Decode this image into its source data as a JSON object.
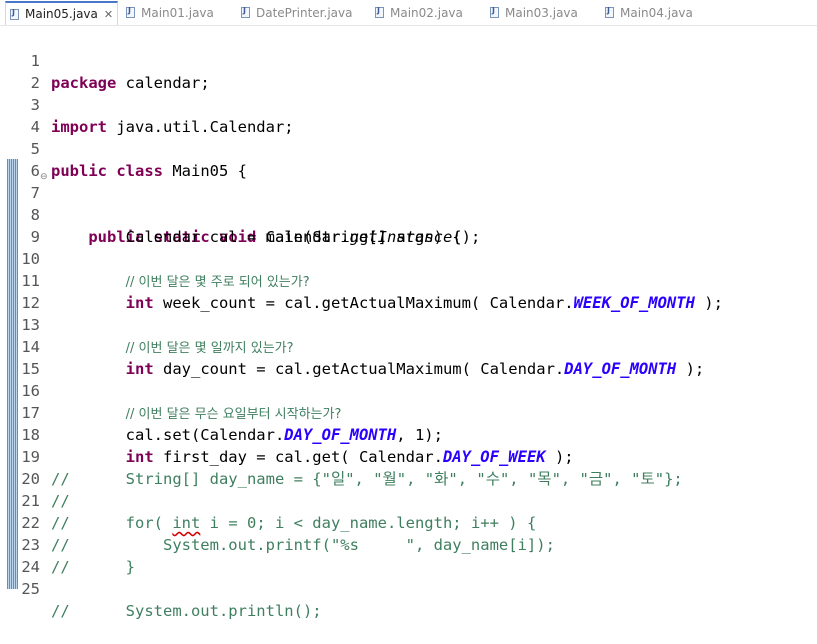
{
  "tabs": [
    {
      "label": "Main05.java",
      "active": true,
      "closable": true
    },
    {
      "label": "Main01.java",
      "active": false
    },
    {
      "label": "DatePrinter.java",
      "active": false
    },
    {
      "label": "Main02.java",
      "active": false
    },
    {
      "label": "Main03.java",
      "active": false
    },
    {
      "label": "Main04.java",
      "active": false
    }
  ],
  "editor": {
    "line_numbers": [
      "1",
      "2",
      "3",
      "4",
      "5",
      "6",
      "7",
      "8",
      "9",
      "10",
      "11",
      "12",
      "13",
      "14",
      "15",
      "16",
      "17",
      "18",
      "19",
      "20",
      "21",
      "22",
      "23",
      "24",
      "25"
    ],
    "code": {
      "l1_kw": "package",
      "l1_rest": " calendar;",
      "l3_kw": "import",
      "l3_rest": " java.util.Calendar;",
      "l5_kw1": "public",
      "l5_kw2": "class",
      "l5_rest": " Main05 {",
      "l7_kw1": "public",
      "l7_kw2": "static",
      "l7_kw3": "void",
      "l7_rest": " main(String[] args) {",
      "l8_a": "Calendar cal = Calendar.",
      "l8_it": "getInstance",
      "l8_b": "();",
      "l10_cm": "// 이번 달은 몇 주로 되어 있는가?",
      "l11_kw": "int",
      "l11_a": " week_count = cal.getActualMaximum( Calendar.",
      "l11_st": "WEEK_OF_MONTH",
      "l11_b": " );",
      "l13_cm": "// 이번 달은 몇 일까지 있는가?",
      "l14_kw": "int",
      "l14_a": " day_count = cal.getActualMaximum( Calendar.",
      "l14_st": "DAY_OF_MONTH",
      "l14_b": " );",
      "l16_cm": "// 이번 달은 무슨 요일부터 시작하는가?",
      "l17_a": "cal.set(Calendar.",
      "l17_st": "DAY_OF_MONTH",
      "l17_b": ", 1);",
      "l18_kw": "int",
      "l18_a": " first_day = cal.get( Calendar.",
      "l18_st": "DAY_OF_WEEK",
      "l18_b": " );",
      "l19_cm": "//      String[] day_name = {\"일\", \"월\", \"화\", \"수\", \"목\", \"금\", \"토\"};",
      "l20_cm": "//",
      "l21_cm_a": "//      for( ",
      "l21_cm_int": "int",
      "l21_cm_b": " i = 0; i < day_name.length; i++ ) {",
      "l22_cm": "//          System.out.printf(\"%s     \", day_name[i]);",
      "l23_cm": "//      }",
      "l25_cm": "//      System.out.println();"
    }
  }
}
